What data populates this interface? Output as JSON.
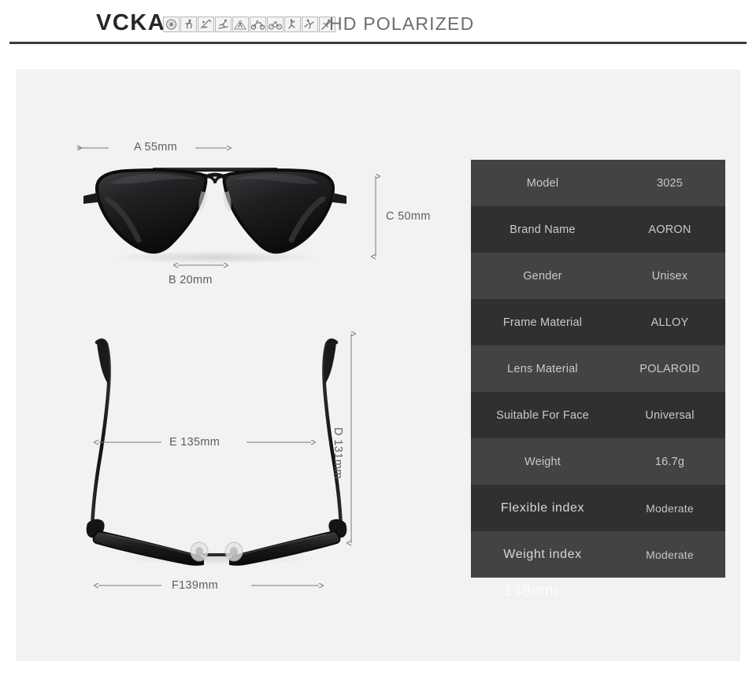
{
  "header": {
    "brand": "VCKA",
    "title": "HD POLARIZED",
    "icons": [
      "compass-icon",
      "running-icon",
      "fishing-icon",
      "skiing-icon",
      "climbing-icon",
      "motorcycle-icon",
      "cycling-icon",
      "skating-icon",
      "golf-icon",
      "snowboarding-icon"
    ]
  },
  "diagram": {
    "front_view": {
      "name": "front-view",
      "labels": {
        "width": "A 55mm",
        "bridge": "B 20mm",
        "height": "C 50mm"
      }
    },
    "top_view": {
      "name": "top-view",
      "labels": {
        "depth": "D 131mm",
        "temple_span": "E 135mm",
        "front_width": "F139mm"
      }
    },
    "watermark": "148mm"
  },
  "spec_table": {
    "rows": [
      {
        "key": "Model",
        "value": "3025"
      },
      {
        "key": "Brand Name",
        "value": "AORON"
      },
      {
        "key": "Gender",
        "value": "Unisex"
      },
      {
        "key": "Frame Material",
        "value": "ALLOY"
      },
      {
        "key": "Lens Material",
        "value": "POLAROID"
      },
      {
        "key": "Suitable For Face",
        "value": "Universal"
      },
      {
        "key": "Weight",
        "value": "16.7g"
      },
      {
        "key": "Flexible index",
        "value": "Moderate"
      },
      {
        "key": "Weight index",
        "value": "Moderate"
      }
    ]
  },
  "colors": {
    "page_background": "#ffffff",
    "panel_background": "#f2f2f2",
    "rule": "#3a3d42",
    "logo": "#272727",
    "title": "#6d6d6d",
    "dimension_text": "#5e5e5e",
    "row_light": "#434343",
    "row_dark": "#303030",
    "row_text": "#c9c9c9"
  }
}
